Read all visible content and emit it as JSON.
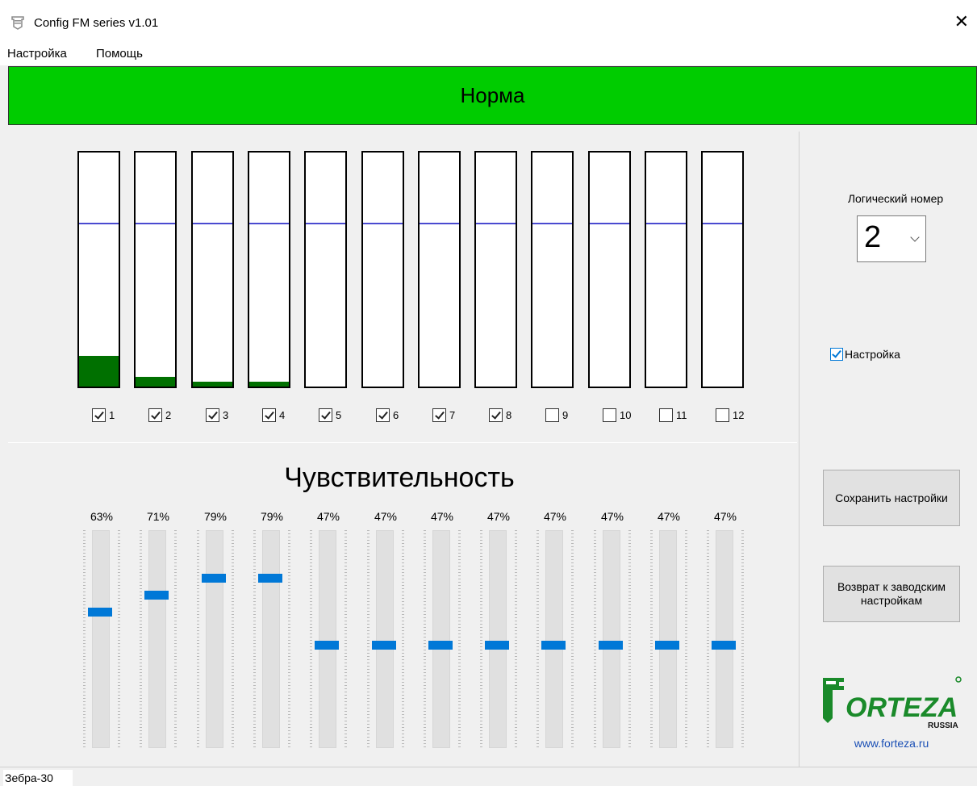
{
  "window": {
    "title": "Config FM series v1.01",
    "close_icon": "close-icon"
  },
  "menu": {
    "items": [
      "Настройка",
      "Помощь"
    ]
  },
  "status": {
    "text": "Норма",
    "color": "#00cc00"
  },
  "channels": [
    {
      "label": "1",
      "checked": true,
      "signal_pct": 13
    },
    {
      "label": "2",
      "checked": true,
      "signal_pct": 4
    },
    {
      "label": "3",
      "checked": true,
      "signal_pct": 2
    },
    {
      "label": "4",
      "checked": true,
      "signal_pct": 2
    },
    {
      "label": "5",
      "checked": true,
      "signal_pct": 0
    },
    {
      "label": "6",
      "checked": true,
      "signal_pct": 0
    },
    {
      "label": "7",
      "checked": true,
      "signal_pct": 0
    },
    {
      "label": "8",
      "checked": true,
      "signal_pct": 0
    },
    {
      "label": "9",
      "checked": false,
      "signal_pct": 0
    },
    {
      "label": "10",
      "checked": false,
      "signal_pct": 0
    },
    {
      "label": "11",
      "checked": false,
      "signal_pct": 0
    },
    {
      "label": "12",
      "checked": false,
      "signal_pct": 0
    }
  ],
  "threshold_pct": 70,
  "sensitivity": {
    "title": "Чувствительность",
    "values": [
      {
        "label": "63%",
        "level": 63
      },
      {
        "label": "71%",
        "level": 71
      },
      {
        "label": "79%",
        "level": 79
      },
      {
        "label": "79%",
        "level": 79
      },
      {
        "label": "47%",
        "level": 47
      },
      {
        "label": "47%",
        "level": 47
      },
      {
        "label": "47%",
        "level": 47
      },
      {
        "label": "47%",
        "level": 47
      },
      {
        "label": "47%",
        "level": 47
      },
      {
        "label": "47%",
        "level": 47
      },
      {
        "label": "47%",
        "level": 47
      },
      {
        "label": "47%",
        "level": 47
      }
    ]
  },
  "side_panel": {
    "logical_number_label": "Логический номер",
    "logical_number_value": "2",
    "setting_checkbox_label": "Настройка",
    "setting_checked": true,
    "save_button": "Сохранить настройки",
    "reset_button": "Возврат к заводским настройкам"
  },
  "logo": {
    "brand": "FORTEZA",
    "subtitle": "RUSSIA",
    "url": "www.forteza.ru"
  },
  "statusbar": {
    "model": "Зебра-30"
  }
}
